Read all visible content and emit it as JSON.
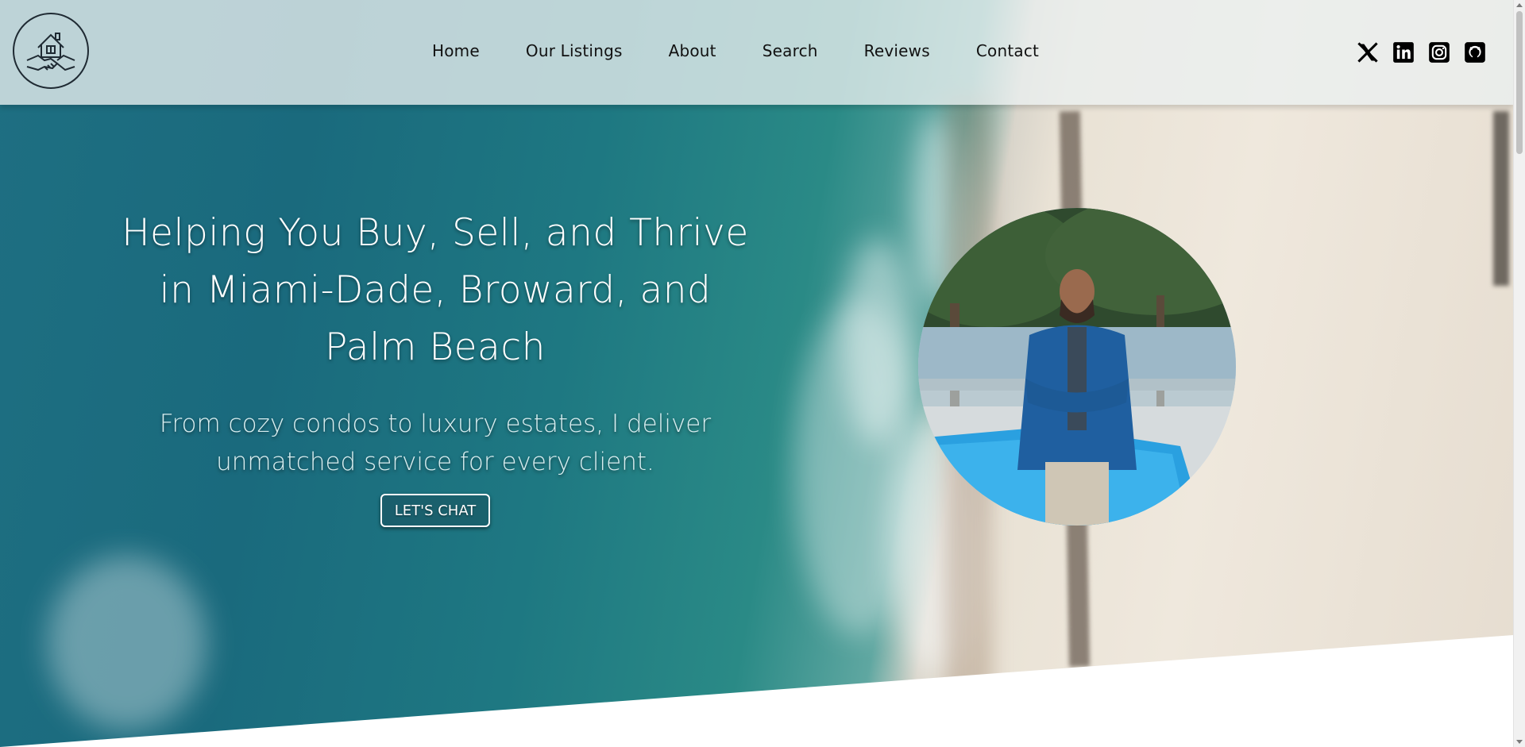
{
  "nav": {
    "items": [
      {
        "label": "Home"
      },
      {
        "label": "Our Listings"
      },
      {
        "label": "About"
      },
      {
        "label": "Search"
      },
      {
        "label": "Reviews"
      },
      {
        "label": "Contact"
      }
    ]
  },
  "socials": [
    {
      "icon": "x-icon"
    },
    {
      "icon": "linkedin-icon"
    },
    {
      "icon": "instagram-icon"
    },
    {
      "icon": "github-icon"
    }
  ],
  "hero": {
    "headline_line1": "Helping You Buy, Sell, and Thrive",
    "headline_line2": "in Miami-Dade, Broward, and",
    "headline_line3": "Palm Beach",
    "subline_line1": "From cozy condos to luxury estates, I deliver",
    "subline_line2": "unmatched service for every client.",
    "cta_label": "LET'S CHAT"
  },
  "colors": {
    "navbar_bg": "#ebf0f0",
    "text_dark": "#111111",
    "headline": "#ffffff",
    "sea": "#1e6f82",
    "sand": "#efe8dd"
  }
}
